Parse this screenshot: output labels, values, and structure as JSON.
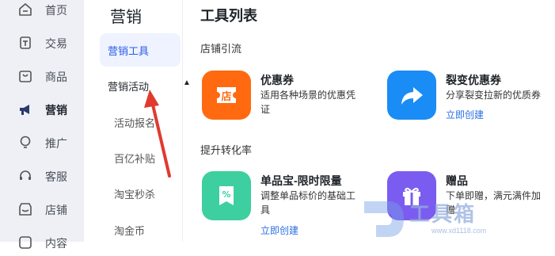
{
  "sidebar": {
    "items": [
      {
        "label": "首页",
        "icon": "home-icon"
      },
      {
        "label": "交易",
        "icon": "order-icon"
      },
      {
        "label": "商品",
        "icon": "bag-icon"
      },
      {
        "label": "营销",
        "icon": "megaphone-icon",
        "active": true
      },
      {
        "label": "推广",
        "icon": "lightbulb-icon"
      },
      {
        "label": "客服",
        "icon": "headset-icon"
      },
      {
        "label": "店铺",
        "icon": "store-icon"
      },
      {
        "label": "内容",
        "icon": "content-icon"
      }
    ]
  },
  "subnav": {
    "title": "营销",
    "items": [
      {
        "label": "营销工具"
      },
      {
        "label": "营销活动"
      }
    ],
    "children": [
      "活动报名",
      "百亿补贴",
      "淘宝秒杀",
      "淘金币"
    ]
  },
  "main": {
    "title": "工具列表",
    "sections": [
      {
        "title": "店铺引流",
        "tools": [
          {
            "name": "优惠券",
            "desc": "适用各种场景的优惠凭证",
            "link": "",
            "icon": "shop-coupon-icon",
            "color": "#ff6a10"
          },
          {
            "name": "裂变优惠券",
            "desc": "分享裂变拉新的优质券",
            "link": "立即创建",
            "icon": "share-arrow-icon",
            "color": "#1a8cf5"
          }
        ]
      },
      {
        "title": "提升转化率",
        "tools": [
          {
            "name": "单品宝-限时限量",
            "desc": "调整单品标价的基础工具",
            "link": "立即创建",
            "icon": "discount-tag-icon",
            "color": "#3dcf9f"
          },
          {
            "name": "赠品",
            "desc": "下单即赠，满元满件加赠",
            "link": "",
            "icon": "gift-icon",
            "color": "#7b5cf0"
          }
        ]
      }
    ]
  },
  "watermark": {
    "text": "工具箱",
    "url": "www.xd1118.com"
  }
}
